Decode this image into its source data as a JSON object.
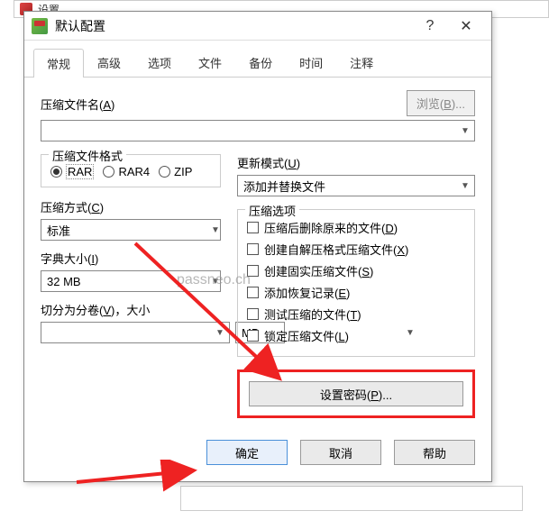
{
  "bg": {
    "title": "设置"
  },
  "dialog": {
    "title": "默认配置",
    "help_symbol": "?",
    "close_symbol": "✕"
  },
  "tabs": [
    "常规",
    "高级",
    "选项",
    "文件",
    "备份",
    "时间",
    "注释"
  ],
  "archive_name": {
    "label": "压缩文件名(",
    "accel": "A",
    "suffix": ")",
    "value": ""
  },
  "browse": {
    "label": "浏览(",
    "accel": "B",
    "suffix": ")..."
  },
  "update_mode": {
    "label": "更新模式(",
    "accel": "U",
    "suffix": ")",
    "value": "添加并替换文件"
  },
  "format": {
    "title": "压缩文件格式",
    "options": [
      "RAR",
      "RAR4",
      "ZIP"
    ],
    "selected": "RAR"
  },
  "method": {
    "label": "压缩方式(",
    "accel": "C",
    "suffix": ")",
    "value": "标准"
  },
  "dict": {
    "label": "字典大小(",
    "accel": "I",
    "suffix": ")",
    "value": "32 MB"
  },
  "split": {
    "label": "切分为分卷(",
    "accel": "V",
    "suffix": ")，大小",
    "value": "",
    "unit": "MB"
  },
  "options": {
    "title": "压缩选项",
    "items": [
      {
        "label": "压缩后删除原来的文件(",
        "accel": "D",
        "suffix": ")"
      },
      {
        "label": "创建自解压格式压缩文件(",
        "accel": "X",
        "suffix": ")"
      },
      {
        "label": "创建固实压缩文件(",
        "accel": "S",
        "suffix": ")"
      },
      {
        "label": "添加恢复记录(",
        "accel": "E",
        "suffix": ")"
      },
      {
        "label": "测试压缩的文件(",
        "accel": "T",
        "suffix": ")"
      },
      {
        "label": "锁定压缩文件(",
        "accel": "L",
        "suffix": ")"
      }
    ]
  },
  "password": {
    "label": "设置密码(",
    "accel": "P",
    "suffix": ")..."
  },
  "buttons": {
    "ok": "确定",
    "cancel": "取消",
    "help": "帮助"
  },
  "watermark": "passneo.ch"
}
